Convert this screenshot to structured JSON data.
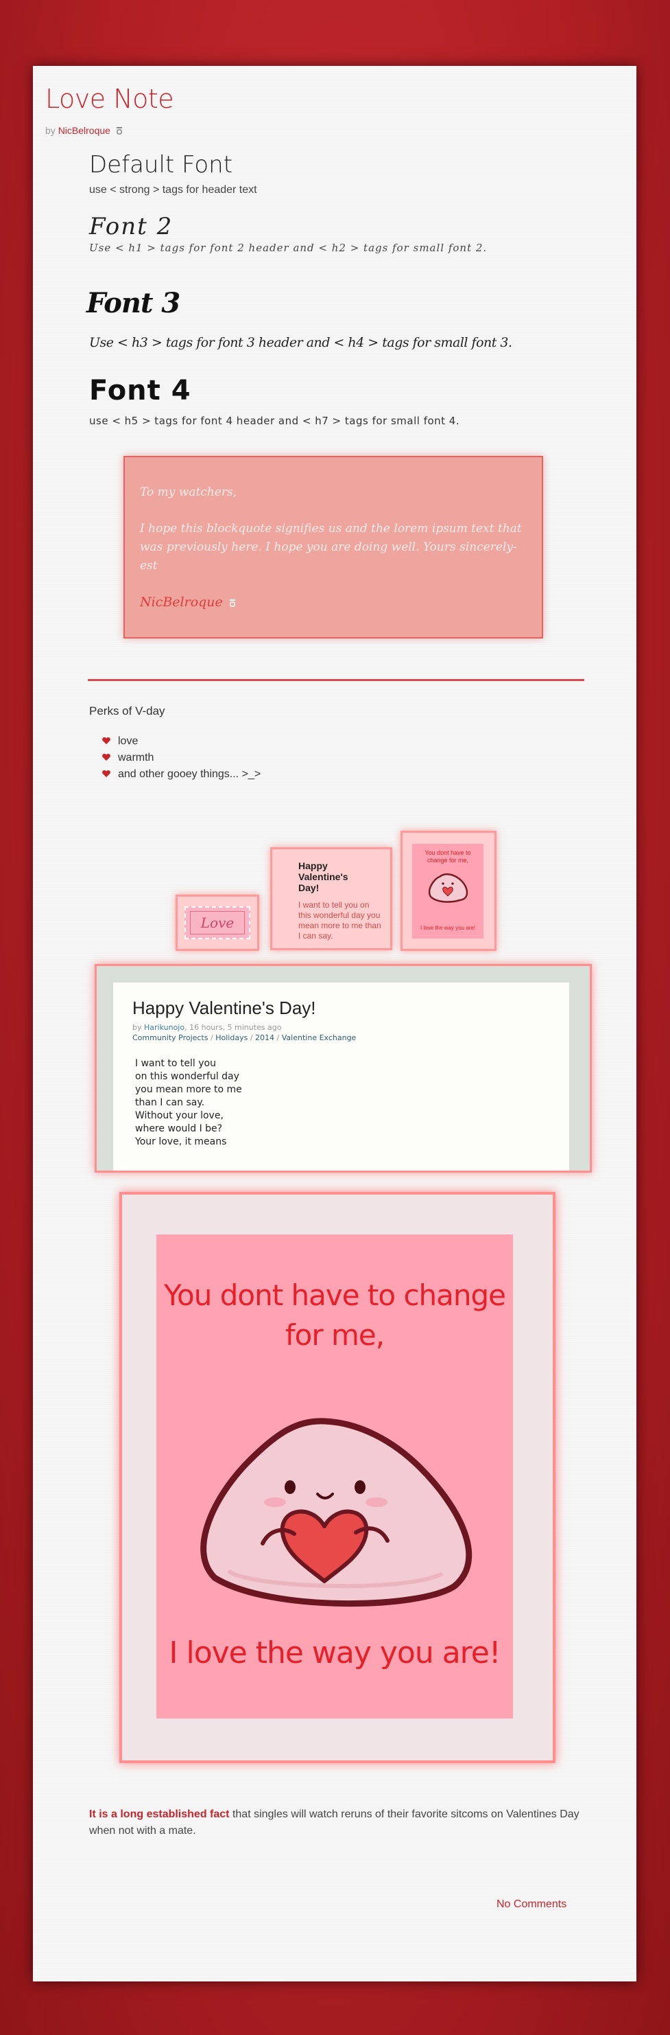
{
  "post": {
    "title": "Love Note",
    "by_prefix": "by",
    "author": "NicBelroque"
  },
  "fonts": {
    "default_header": "Default Font",
    "default_text": "use < strong > tags for header text",
    "font2_header": "Font 2",
    "font2_text": "Use < h1 > tags for font 2 header and < h2 > tags for small font 2.",
    "font3_header": "Font 3",
    "font3_text": "Use < h3 > tags for font 3 header and < h4 > tags for small font 3.",
    "font4_header": "Font 4",
    "font4_text": "use < h5 > tags for font 4 header and < h7 > tags for small font 4."
  },
  "blockquote": {
    "greeting": "To my watchers,",
    "body": "I hope this blockquote signifies us and the lorem ipsum text that was previously here. I hope you are doing well. Yours sincerely-est",
    "signature": "NicBelroque"
  },
  "perks": {
    "title": "Perks of V-day",
    "items": [
      "love",
      "warmth",
      "and other gooey things... >_>"
    ]
  },
  "thumbs": {
    "stamp_text": "Love",
    "card_title": "Happy Valentine's Day!",
    "card_text": "I want to tell you on this wonderful day you mean more to me than I can say.",
    "mini_top": "You dont have to change for me,",
    "mini_bottom": "I love the way you are!"
  },
  "preview": {
    "title": "Happy Valentine's Day!",
    "by_prefix": "by",
    "author": "Harikunojo",
    "time": "16 hours, 5 minutes ago",
    "crumbs": [
      "Community Projects",
      "Holidays",
      "2014",
      "Valentine Exchange"
    ],
    "body_lines": [
      "I want to tell you",
      "on this wonderful day",
      "you mean more to me",
      "than I can say.",
      "Without your love,",
      "where would I be?",
      "Your love, it means"
    ]
  },
  "big_card": {
    "top_text": "You dont have to change for me,",
    "bottom_text": "I love the way you are!"
  },
  "footer": {
    "lead": "It is a long established fact",
    "rest": " that singles will watch reruns of their favorite sitcoms on Valentines Day when not with a mate.",
    "comments": "No Comments"
  },
  "colors": {
    "accent": "#c8252b",
    "background": "#b01f24",
    "quote_bg": "#eea59d",
    "card_pink": "#ffa3b3"
  },
  "icons": [
    "glyph-icon",
    "heart-icon"
  ]
}
